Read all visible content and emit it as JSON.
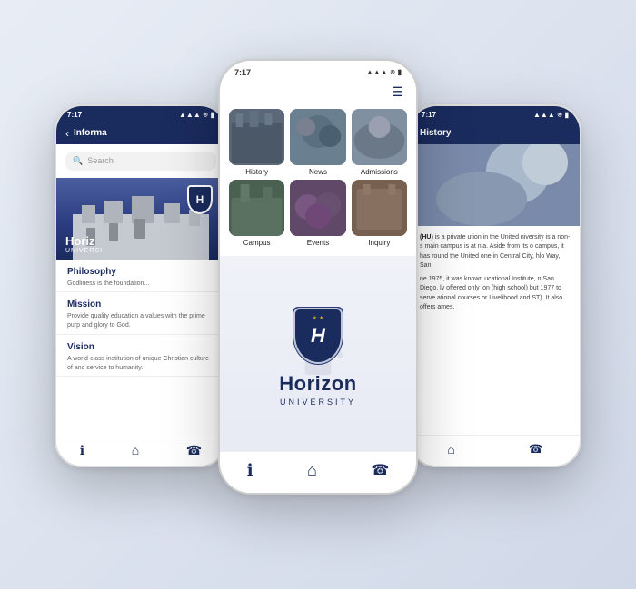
{
  "app": {
    "name": "Horizon University",
    "tagline": "UNIVERSITY",
    "shield_letter": "H"
  },
  "left_phone": {
    "status_time": "7:17",
    "nav_title": "Informa",
    "search_placeholder": "Search",
    "hero_university": "Horiz",
    "hero_sub": "UNIVERSI",
    "sections": [
      {
        "title": "Philosophy",
        "text": "Godliness is the foundation..."
      },
      {
        "title": "Mission",
        "text": "Provide quality education a values with the prime purp and glory to God."
      },
      {
        "title": "Vision",
        "text": "A world-class institution of unique Christian culture of and service to humanity."
      }
    ],
    "bottom_nav": [
      "ℹ",
      "⌂",
      "☎"
    ]
  },
  "center_phone": {
    "status_time": "7:17",
    "grid_items": [
      {
        "label": "History",
        "thumb_class": "thumb-history"
      },
      {
        "label": "News",
        "thumb_class": "thumb-news"
      },
      {
        "label": "Admissions",
        "thumb_class": "thumb-admissions"
      },
      {
        "label": "Campus",
        "thumb_class": "thumb-campus"
      },
      {
        "label": "Events",
        "thumb_class": "thumb-events"
      },
      {
        "label": "Inquiry",
        "thumb_class": "thumb-inquiry"
      }
    ],
    "splash_name": "Horizon",
    "splash_sub": "UNIVERSITY",
    "bottom_nav": [
      "ℹ",
      "⌂",
      "☎"
    ]
  },
  "right_phone": {
    "status_time": "7:17",
    "nav_title": "History",
    "body_text": "(HU) is a private ution in the United niversity is a non- s main campus is at nia. Aside from its o campus, it has round the United one in Central City, hlo Way, San",
    "body_text2": "ne 1975, it was known ucational Institute, n San Diego, ly offered only ion (high school) but 1977 to serve ational courses or Livelihood and ST). It also offers ames.",
    "is_private_text": "is a private",
    "bottom_nav": [
      "⌂",
      "☎"
    ]
  },
  "colors": {
    "brand_dark": "#1a2b5e",
    "brand_mid": "#2a3b7e",
    "accent": "#c0a030",
    "text_dark": "#222",
    "text_grey": "#666"
  }
}
